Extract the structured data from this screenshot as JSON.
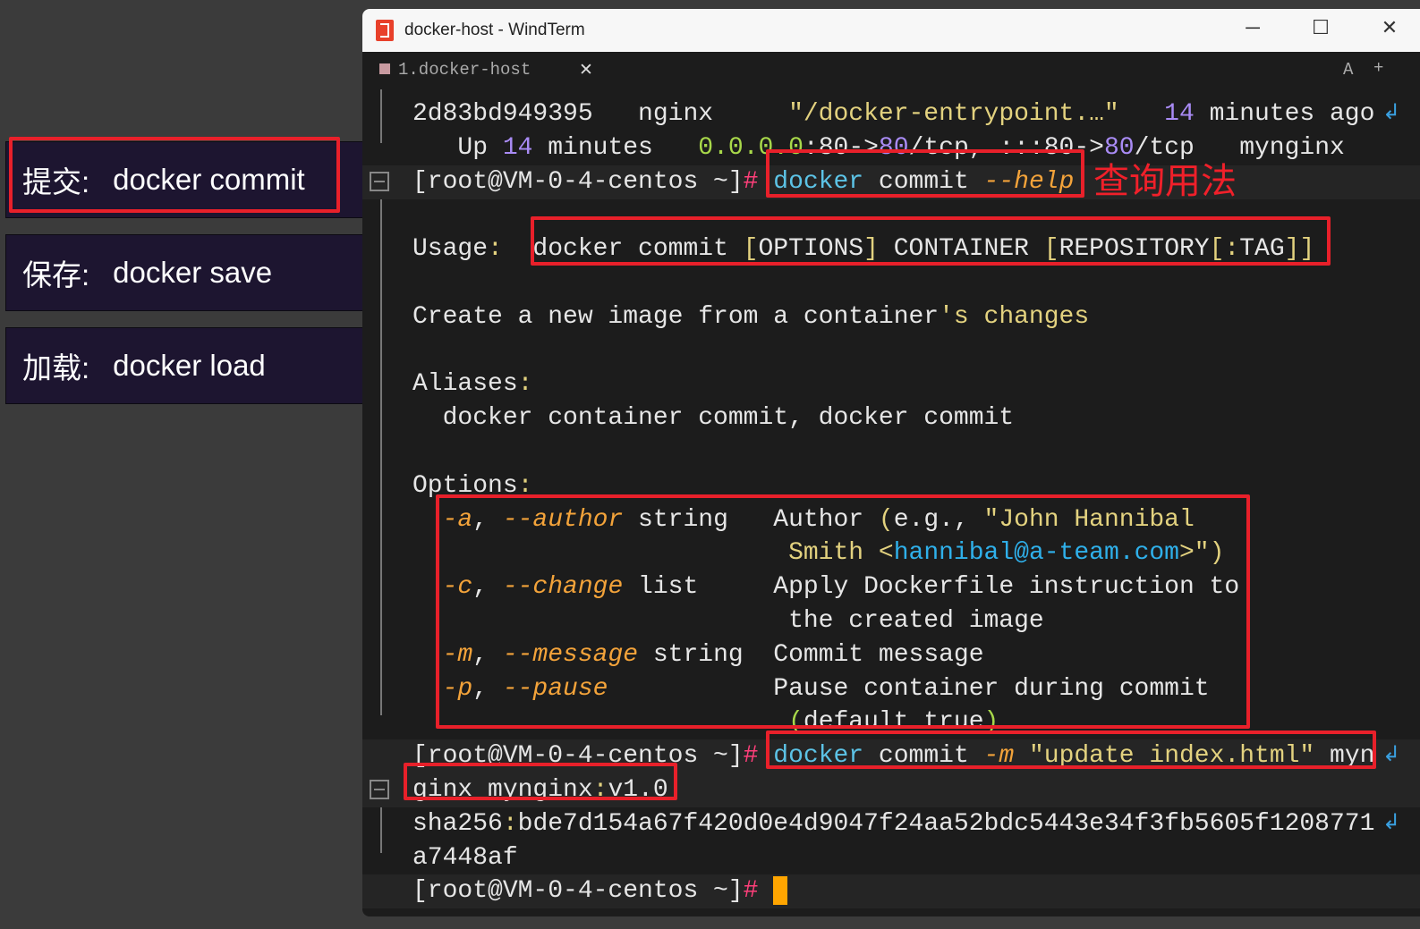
{
  "side_panel": [
    {
      "zh": "提交:",
      "cmd": "docker commit"
    },
    {
      "zh": "保存:",
      "cmd": "docker save"
    },
    {
      "zh": "加载:",
      "cmd": "docker load"
    }
  ],
  "window": {
    "title": "docker-host - WindTerm",
    "minimize": "─",
    "maximize": "☐",
    "close": "✕"
  },
  "tab": {
    "label": "1.docker-host",
    "close": "✕",
    "font_btn": "A",
    "add_btn": "+"
  },
  "annotation": "查询用法",
  "colors": {
    "accent_red": "#e8202a",
    "cursor": "#ffa500",
    "prompt_hash": "#ff3f7a",
    "command": "#5cc3e6",
    "flag": "#f3a33a"
  },
  "terminal": {
    "lines": [
      {
        "segs": [
          {
            "t": "2d83bd949395   nginx     ",
            "c": "w"
          },
          {
            "t": "\"/docker-entrypoint.…\"",
            "c": "ye"
          },
          {
            "t": "   ",
            "c": "w"
          },
          {
            "t": "14",
            "c": "pu"
          },
          {
            "t": " minutes ago",
            "c": "w"
          }
        ],
        "wrap": true
      },
      {
        "segs": [
          {
            "t": "   Up ",
            "c": "w"
          },
          {
            "t": "14",
            "c": "pu"
          },
          {
            "t": " minutes   ",
            "c": "w"
          },
          {
            "t": "0.0.0.0",
            "c": "gr"
          },
          {
            "t": ":80->",
            "c": "w"
          },
          {
            "t": "80",
            "c": "pu"
          },
          {
            "t": "/tcp, :::80->",
            "c": "w"
          },
          {
            "t": "80",
            "c": "pu"
          },
          {
            "t": "/tcp   mynginx",
            "c": "w"
          }
        ]
      },
      {
        "segs": [
          {
            "t": "[root@VM-0-4-centos ~]",
            "c": "w"
          },
          {
            "t": "#",
            "c": "pk"
          },
          {
            "t": " ",
            "c": "w"
          },
          {
            "t": "docker",
            "c": "cy"
          },
          {
            "t": " commit ",
            "c": "w"
          },
          {
            "t": "--help",
            "c": "or"
          }
        ],
        "hl": true,
        "fold": true
      },
      {
        "segs": []
      },
      {
        "segs": [
          {
            "t": "Usage",
            "c": "w"
          },
          {
            "t": ":",
            "c": "ye"
          },
          {
            "t": "  docker commit ",
            "c": "w"
          },
          {
            "t": "[",
            "c": "ye"
          },
          {
            "t": "OPTIONS",
            "c": "w"
          },
          {
            "t": "]",
            "c": "ye"
          },
          {
            "t": " CONTAINER ",
            "c": "w"
          },
          {
            "t": "[",
            "c": "ye"
          },
          {
            "t": "REPOSITORY",
            "c": "w"
          },
          {
            "t": "[:",
            "c": "ye"
          },
          {
            "t": "TAG",
            "c": "w"
          },
          {
            "t": "]]",
            "c": "ye"
          }
        ]
      },
      {
        "segs": []
      },
      {
        "segs": [
          {
            "t": "Create a new image from a container",
            "c": "w"
          },
          {
            "t": "'s changes",
            "c": "ye"
          }
        ]
      },
      {
        "segs": []
      },
      {
        "segs": [
          {
            "t": "Aliases",
            "c": "w"
          },
          {
            "t": ":",
            "c": "ye"
          }
        ]
      },
      {
        "segs": [
          {
            "t": "  docker container commit, docker commit",
            "c": "w"
          }
        ]
      },
      {
        "segs": []
      },
      {
        "segs": [
          {
            "t": "Options",
            "c": "w"
          },
          {
            "t": ":",
            "c": "ye"
          }
        ]
      },
      {
        "segs": [
          {
            "t": "  ",
            "c": "w"
          },
          {
            "t": "-a",
            "c": "or"
          },
          {
            "t": ", ",
            "c": "w"
          },
          {
            "t": "--author",
            "c": "or"
          },
          {
            "t": " string   Author ",
            "c": "w"
          },
          {
            "t": "(",
            "c": "ye"
          },
          {
            "t": "e.g., ",
            "c": "w"
          },
          {
            "t": "\"John Hannibal",
            "c": "ye"
          }
        ]
      },
      {
        "segs": [
          {
            "t": "                         ",
            "c": "w"
          },
          {
            "t": "Smith ",
            "c": "ye"
          },
          {
            "t": "<",
            "c": "ye"
          },
          {
            "t": "hannibal@a-team.com",
            "c": "lb"
          },
          {
            "t": ">\")",
            "c": "ye"
          }
        ]
      },
      {
        "segs": [
          {
            "t": "  ",
            "c": "w"
          },
          {
            "t": "-c",
            "c": "or"
          },
          {
            "t": ", ",
            "c": "w"
          },
          {
            "t": "--change",
            "c": "or"
          },
          {
            "t": " list     Apply Dockerfile instruction to",
            "c": "w"
          }
        ]
      },
      {
        "segs": [
          {
            "t": "                         the created image",
            "c": "w"
          }
        ]
      },
      {
        "segs": [
          {
            "t": "  ",
            "c": "w"
          },
          {
            "t": "-m",
            "c": "or"
          },
          {
            "t": ", ",
            "c": "w"
          },
          {
            "t": "--message",
            "c": "or"
          },
          {
            "t": " string  Commit message",
            "c": "w"
          }
        ]
      },
      {
        "segs": [
          {
            "t": "  ",
            "c": "w"
          },
          {
            "t": "-p",
            "c": "or"
          },
          {
            "t": ", ",
            "c": "w"
          },
          {
            "t": "--pause",
            "c": "or"
          },
          {
            "t": "           Pause container during commit",
            "c": "w"
          }
        ]
      },
      {
        "segs": [
          {
            "t": "                         ",
            "c": "w"
          },
          {
            "t": "(",
            "c": "gr"
          },
          {
            "t": "default true",
            "c": "w"
          },
          {
            "t": ")",
            "c": "gr"
          }
        ]
      },
      {
        "segs": [
          {
            "t": "[root@VM-0-4-centos ~]",
            "c": "w"
          },
          {
            "t": "#",
            "c": "pk"
          },
          {
            "t": " ",
            "c": "w"
          },
          {
            "t": "docker",
            "c": "cy"
          },
          {
            "t": " commit ",
            "c": "w"
          },
          {
            "t": "-m",
            "c": "or"
          },
          {
            "t": " ",
            "c": "w"
          },
          {
            "t": "\"update index.html\"",
            "c": "ye"
          },
          {
            "t": " myn",
            "c": "w"
          }
        ],
        "hl": true,
        "wrap": true
      },
      {
        "segs": [
          {
            "t": "ginx mynginx",
            "c": "w"
          },
          {
            "t": ":",
            "c": "ye"
          },
          {
            "t": "v1.0",
            "c": "w"
          }
        ],
        "hl": true,
        "fold": true
      },
      {
        "segs": [
          {
            "t": "sha256",
            "c": "w"
          },
          {
            "t": ":",
            "c": "ye"
          },
          {
            "t": "bde7d154a67f420d0e4d9047f24aa52bdc5443e34f3fb5605f1208771",
            "c": "w"
          }
        ],
        "wrap": true
      },
      {
        "segs": [
          {
            "t": "a7448af",
            "c": "w"
          }
        ]
      },
      {
        "segs": [
          {
            "t": "[root@VM-0-4-centos ~]",
            "c": "w"
          },
          {
            "t": "#",
            "c": "pk"
          },
          {
            "t": " ",
            "c": "w"
          }
        ],
        "hl": true,
        "cursor": true
      }
    ]
  }
}
